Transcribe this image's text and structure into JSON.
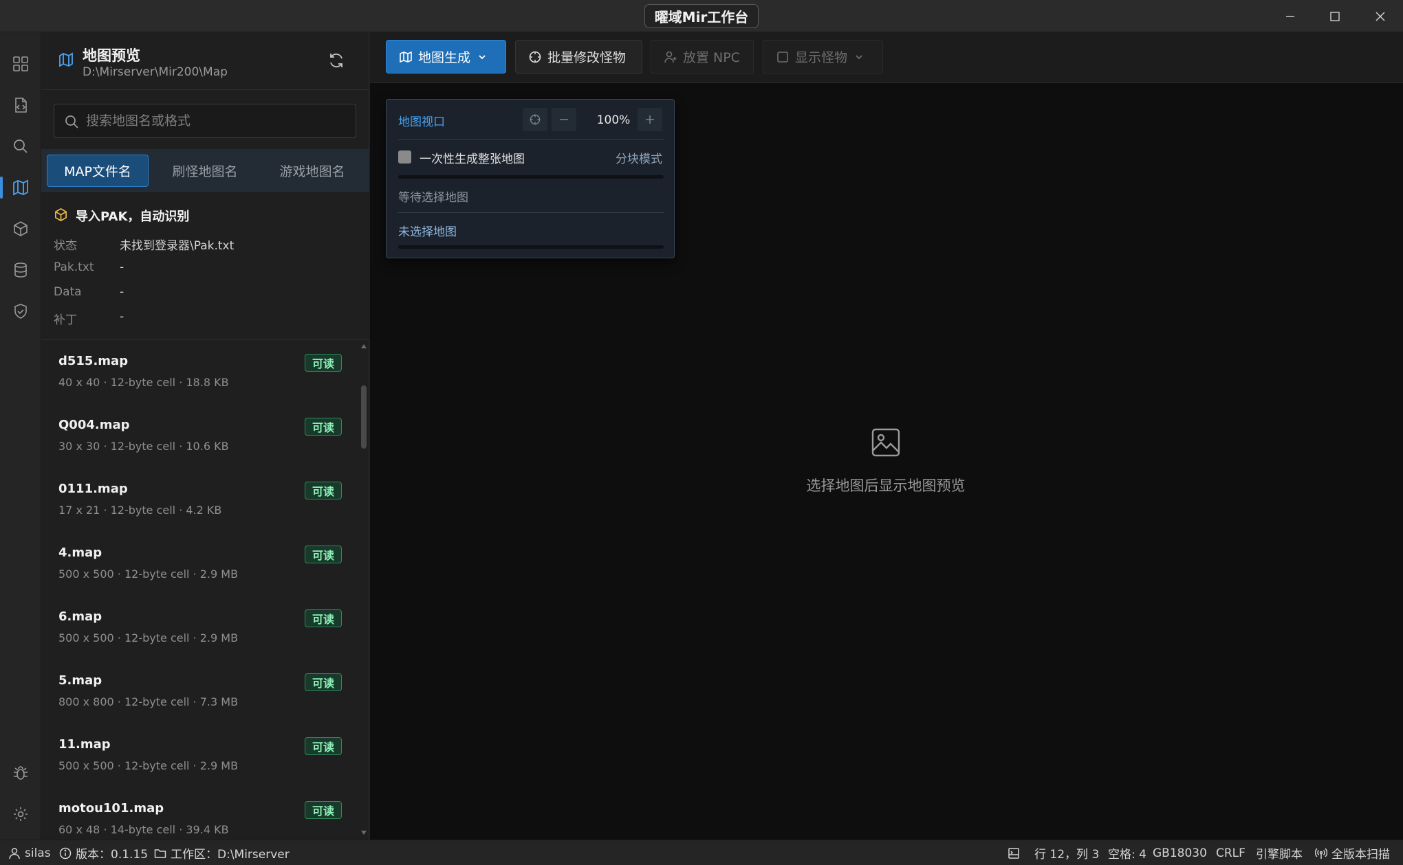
{
  "app": {
    "title": "曜域Mir工作台"
  },
  "sidebar": {
    "title": "地图预览",
    "path": "D:\\Mirserver\\Mir200\\Map",
    "search_placeholder": "搜索地图名或格式",
    "tabs": [
      {
        "label": "MAP文件名",
        "active": true
      },
      {
        "label": "刷怪地图名",
        "active": false
      },
      {
        "label": "游戏地图名",
        "active": false
      }
    ],
    "pak": {
      "title": "导入PAK，自动识别",
      "rows": [
        {
          "key": "状态",
          "value": "未找到登录器\\Pak.txt"
        },
        {
          "key": "Pak.txt",
          "value": "-"
        },
        {
          "key": "Data",
          "value": "-"
        },
        {
          "key": "补丁",
          "value": "-"
        }
      ]
    },
    "files": [
      {
        "name": "d515.map",
        "meta": "40 x 40 · 12-byte cell · 18.8 KB",
        "badge": "可读"
      },
      {
        "name": "Q004.map",
        "meta": "30 x 30 · 12-byte cell · 10.6 KB",
        "badge": "可读"
      },
      {
        "name": "0111.map",
        "meta": "17 x 21 · 12-byte cell · 4.2 KB",
        "badge": "可读"
      },
      {
        "name": "4.map",
        "meta": "500 x 500 · 12-byte cell · 2.9 MB",
        "badge": "可读"
      },
      {
        "name": "6.map",
        "meta": "500 x 500 · 12-byte cell · 2.9 MB",
        "badge": "可读"
      },
      {
        "name": "5.map",
        "meta": "800 x 800 · 12-byte cell · 7.3 MB",
        "badge": "可读"
      },
      {
        "name": "11.map",
        "meta": "500 x 500 · 12-byte cell · 2.9 MB",
        "badge": "可读"
      },
      {
        "name": "motou101.map",
        "meta": "60 x 48 · 14-byte cell · 39.4 KB",
        "badge": "可读"
      }
    ]
  },
  "toolbar": {
    "map_gen": "地图生成",
    "batch_edit": "批量修改怪物",
    "place_npc": "放置 NPC",
    "show_monsters": "显示怪物"
  },
  "popup": {
    "title": "地图视口",
    "zoom": "100%",
    "checkbox_label": "一次性生成整张地图",
    "mode_label": "分块模式",
    "status1": "等待选择地图",
    "status2": "未选择地图"
  },
  "main": {
    "empty_text": "选择地图后显示地图预览"
  },
  "statusbar": {
    "user": "silas",
    "version": "版本：0.1.15",
    "workspace": "工作区：D:\\Mirserver",
    "position": "行 12，列 3",
    "spaces": "空格: 4",
    "encoding": "GB18030",
    "eol": "CRLF",
    "engine": "引擎脚本",
    "scan": "全版本扫描"
  }
}
